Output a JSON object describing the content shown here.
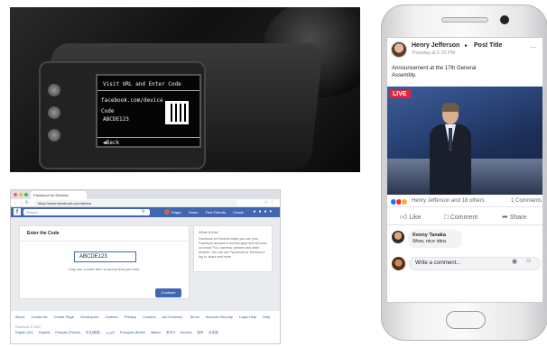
{
  "camera": {
    "screen_title": "Visit URL and Enter Code",
    "url": "facebook.com/device",
    "code_label": "Code",
    "code_value": "ABCDE123",
    "back_label": "◀Back"
  },
  "browser": {
    "tab_title": "Facebook for Devices",
    "address": "https://www.facebook.com/device",
    "search_placeholder": "Search",
    "nav_user": "Edgar",
    "nav_items": [
      "Home",
      "Find Friends",
      "Create"
    ],
    "card_title": "Enter the Code",
    "code_value": "ABCDE123",
    "hint": "Only use a code from a source that you trust.",
    "continue_label": "Continue",
    "side_heading": "What is this?",
    "side_text": "Facebook for Devices helps you use your Facebook account to access apps and services on smart TVs, cameras, printers and other devices. You can use Facebook for Devices to log in, share and more.",
    "footer_links": [
      "About",
      "Create Ad",
      "Create Page",
      "Developers",
      "Careers",
      "Privacy",
      "Cookies",
      "Ad Choices▷",
      "Terms",
      "Account Security",
      "Login Help",
      "Help"
    ],
    "copyright": "Facebook © 2019",
    "languages": [
      "English (US)",
      "Español",
      "Français (France)",
      "中文(简体)",
      "العربية",
      "Português (Brasil)",
      "Italiano",
      "한국어",
      "Deutsch",
      "हिन्दी",
      "日本語"
    ]
  },
  "phone": {
    "author": "Henry Jefferson",
    "arrow": "▸",
    "post_title": "Post Title",
    "timestamp": "Thursday at 3 :02 PM ·",
    "body": "Announcement at the 17th General Assembly.",
    "live_badge": "LIVE",
    "reactions_text": "Henry Jefferson and 18 others",
    "comments_count": "1 Comments",
    "like_label": "Like",
    "comment_label": "Comment",
    "share_label": "Share",
    "commenter": "Kenny Tanaka",
    "comment_text": "Wow, nice idea",
    "write_placeholder": "Write a comment..."
  },
  "colors": {
    "facebook_blue": "#4267b2",
    "live_red": "#e4233f",
    "like_blue": "#1877f2",
    "love_red": "#f0284a",
    "haha_yellow": "#f7b125"
  }
}
